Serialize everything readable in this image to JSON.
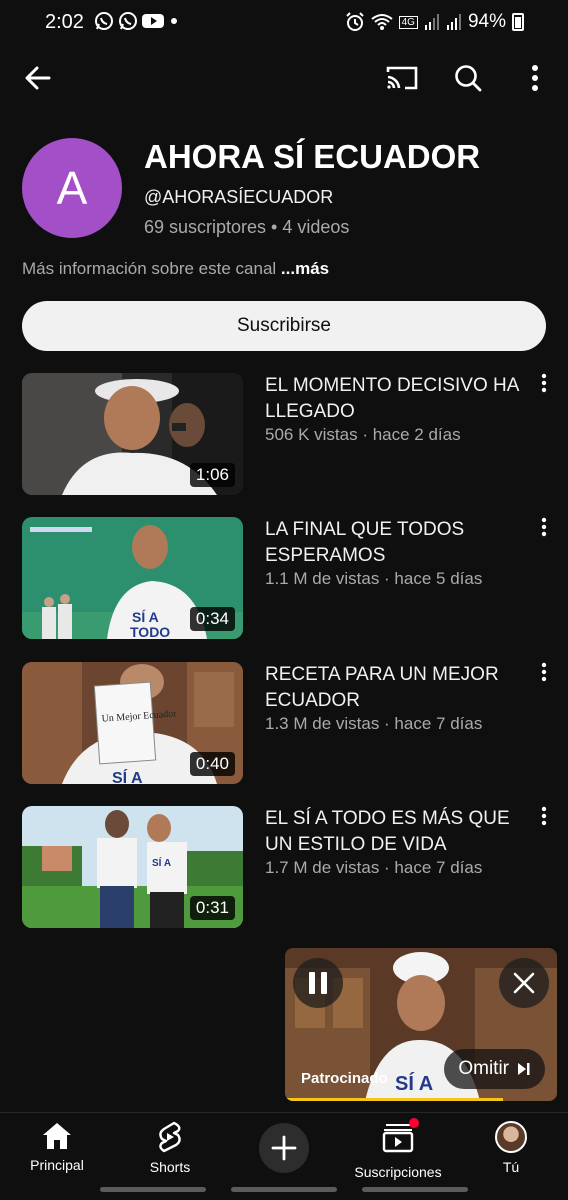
{
  "status_bar": {
    "time": "2:02",
    "battery": "94%",
    "network_badge": "4G",
    "left_icons": [
      "whatsapp-icon",
      "whatsapp-icon",
      "youtube-icon",
      "dot"
    ],
    "right_icons": [
      "alarm-icon",
      "wifi-icon",
      "signal-icon",
      "signal-icon",
      "battery-icon"
    ]
  },
  "toolbar": {
    "icons": [
      "back-arrow-icon",
      "cast-icon",
      "search-icon",
      "more-vert-icon"
    ]
  },
  "channel": {
    "avatar_letter": "A",
    "avatar_color": "#a34fc7",
    "name": "AHORA SÍ ECUADOR",
    "handle": "@AHORASÍECUADOR",
    "stats": "69 suscriptores • 4 videos",
    "about": "Más información sobre este canal",
    "about_more": "...más",
    "subscribe_label": "Suscribirse"
  },
  "videos": [
    {
      "title": "EL MOMENTO DECISIVO HA LLEGADO",
      "meta": "506 K vistas · hace 2 días",
      "duration": "1:06"
    },
    {
      "title": "LA FINAL QUE TODOS ESPERAMOS",
      "meta": "1.1 M de vistas · hace 5 días",
      "duration": "0:34"
    },
    {
      "title": "RECETA PARA UN MEJOR ECUADOR",
      "meta": "1.3 M de vistas · hace 7 días",
      "duration": "0:40",
      "thumb_book_text": "Un Mejor Ecuador"
    },
    {
      "title": "EL SÍ A TODO ES MÁS QUE UN ESTILO DE VIDA",
      "meta": "1.7 M de vistas · hace 7 días",
      "duration": "0:31"
    }
  ],
  "mini_player": {
    "sponsored_label": "Patrocinado",
    "skip_label": "Omitir",
    "progress": 0.8,
    "accent": "#f5c518"
  },
  "bottom_nav": {
    "items": [
      {
        "label": "Principal",
        "icon": "home-icon"
      },
      {
        "label": "Shorts",
        "icon": "shorts-icon"
      },
      {
        "label": "",
        "icon": "create-icon"
      },
      {
        "label": "Suscripciones",
        "icon": "subscriptions-icon"
      },
      {
        "label": "Tú",
        "icon": "avatar"
      }
    ]
  }
}
